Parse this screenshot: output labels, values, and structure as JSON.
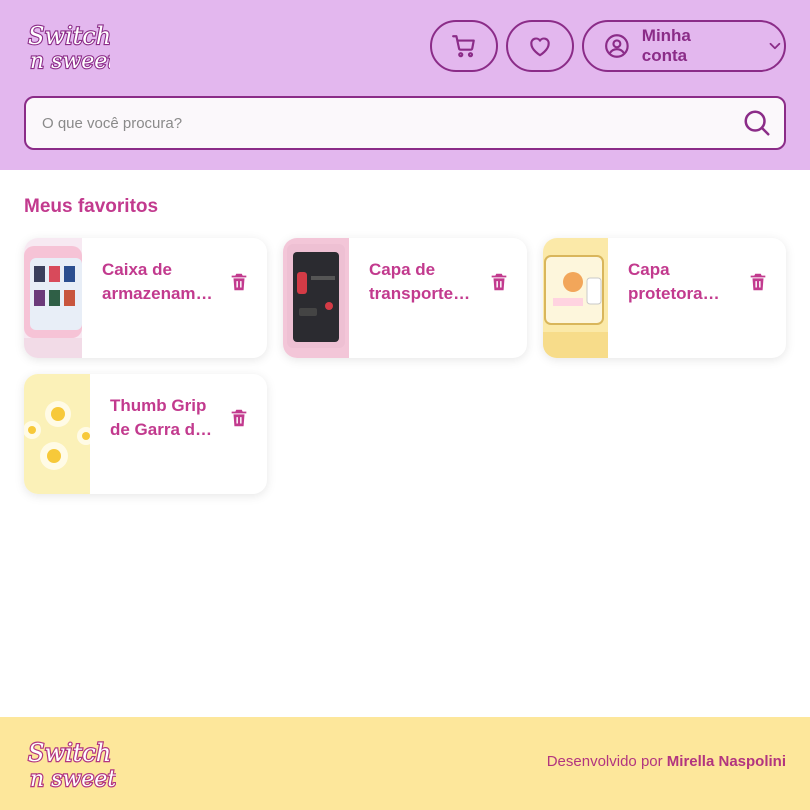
{
  "brand": {
    "logo_text_line1": "Switch",
    "logo_text_line2": "n sweet"
  },
  "header": {
    "cart_icon": "cart-icon",
    "favorites_icon": "heart-icon",
    "account_label": "Minha conta"
  },
  "search": {
    "placeholder": "O que você procura?",
    "value": ""
  },
  "main": {
    "title": "Meus favoritos",
    "favorites": [
      {
        "title": "Caixa de armazenamento para jogos"
      },
      {
        "title": "Capa de transporte para Switch"
      },
      {
        "title": "Capa protetora Switch"
      },
      {
        "title": "Thumb Grip de Garra de Gato"
      }
    ]
  },
  "footer": {
    "credit_prefix": "Desenvolvido por",
    "credit_name": "Mirella Naspolini"
  },
  "colors": {
    "header_bg": "#e3b7ee",
    "accent": "#8b2c88",
    "title_pink": "#c23a8e",
    "footer_bg": "#fde79b"
  }
}
